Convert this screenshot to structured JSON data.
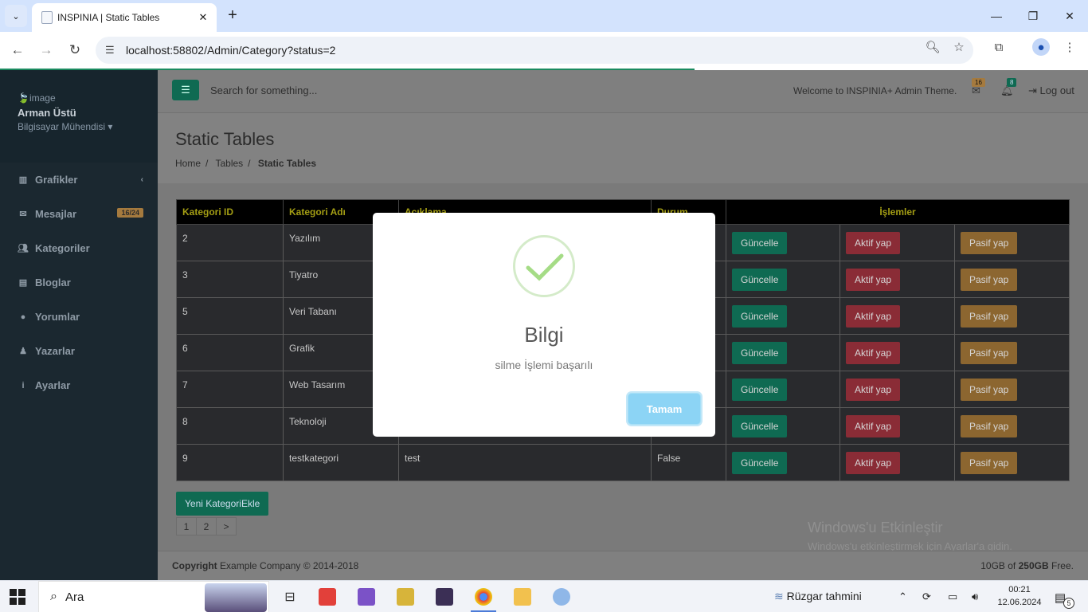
{
  "browser": {
    "tab_title": "INSPINIA | Static Tables",
    "url": "localhost:58802/Admin/Category?status=2"
  },
  "sidebar": {
    "profile_image_alt": "image",
    "user_name": "Arman Üstü",
    "user_role": "Bilgisayar Mühendisi",
    "items": [
      {
        "label": "Grafikler",
        "icon": "bar-chart-icon"
      },
      {
        "label": "Mesajlar",
        "icon": "envelope-icon",
        "badge": "16/24"
      },
      {
        "label": "Kategoriler",
        "icon": "users-icon"
      },
      {
        "label": "Bloglar",
        "icon": "list-icon"
      },
      {
        "label": "Yorumlar",
        "icon": "comment-icon"
      },
      {
        "label": "Yazarlar",
        "icon": "user-icon"
      },
      {
        "label": "Ayarlar",
        "icon": "info-icon"
      }
    ]
  },
  "topbar": {
    "search_placeholder": "Search for something...",
    "welcome": "Welcome to INSPINIA+ Admin Theme.",
    "mail_count": "16",
    "alert_count": "8",
    "logout": "Log out"
  },
  "page": {
    "title": "Static Tables",
    "breadcrumb": [
      "Home",
      "Tables",
      "Static Tables"
    ]
  },
  "table": {
    "headers": [
      "Kategori ID",
      "Kategori Adı",
      "Açıklama",
      "Durum",
      "İşlemler"
    ],
    "rows": [
      {
        "id": "2",
        "name": "Yazılım",
        "desc": "",
        "status": ""
      },
      {
        "id": "3",
        "name": "Tiyatro",
        "desc": "",
        "status": ""
      },
      {
        "id": "5",
        "name": "Veri Tabanı",
        "desc": "",
        "status": ""
      },
      {
        "id": "6",
        "name": "Grafik",
        "desc": "",
        "status": ""
      },
      {
        "id": "7",
        "name": "Web Tasarım",
        "desc": "",
        "status": ""
      },
      {
        "id": "8",
        "name": "Teknoloji",
        "desc": "",
        "status": ""
      },
      {
        "id": "9",
        "name": "testkategori",
        "desc": "test",
        "status": "False"
      }
    ],
    "actions": {
      "update": "Güncelle",
      "activate": "Aktif yap",
      "deactivate": "Pasif yap"
    }
  },
  "new_category_button": "Yeni KategoriEkle",
  "pagination": [
    "1",
    "2",
    ">"
  ],
  "watermark": {
    "line1": "Windows'u Etkinleştir",
    "line2": "Windows'u etkinleştirmek için Ayarlar'a gidin."
  },
  "footer": {
    "copyright_label": "Copyright",
    "copyright_text": "Example Company © 2014-2018",
    "storage_used": "10GB of",
    "storage_total": "250GB",
    "storage_suffix": "Free."
  },
  "modal": {
    "title": "Bilgi",
    "message": "silme İşlemi başarılı",
    "ok_button": "Tamam"
  },
  "taskbar": {
    "search": "Ara",
    "weather": "Rüzgar tahmini",
    "time": "00:21",
    "date": "12.06.2024",
    "notifications": "5"
  },
  "colors": {
    "accent": "#1ab394",
    "danger": "#ed5565",
    "warning": "#f8ac59",
    "header_text": "#a49e14",
    "check": "#a5dc86",
    "ok_button": "#8cd4f5"
  }
}
